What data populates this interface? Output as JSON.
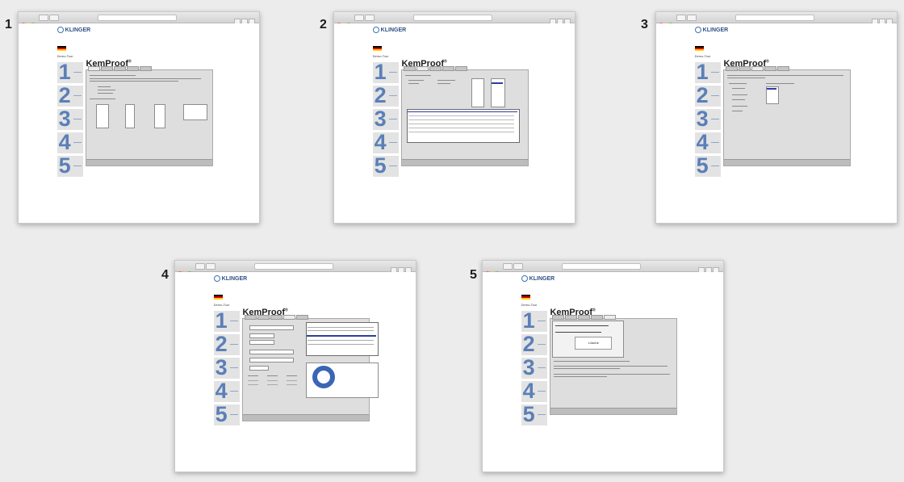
{
  "steps": [
    {
      "number": "1"
    },
    {
      "number": "2"
    },
    {
      "number": "3"
    },
    {
      "number": "4"
    },
    {
      "number": "5"
    }
  ],
  "app": {
    "logo_text": "KLINGER",
    "product_title": "KemProof",
    "registered_mark": "®",
    "demo_label": "Demo-Tour"
  },
  "sidebar_steps": [
    "1",
    "2",
    "3",
    "4",
    "5"
  ],
  "step5": {
    "button_label": "Lösche"
  },
  "colors": {
    "accent": "#3b66b6",
    "step_digit": "#5b7fb7",
    "selection": "#2c3f9d",
    "background": "#ececec"
  }
}
